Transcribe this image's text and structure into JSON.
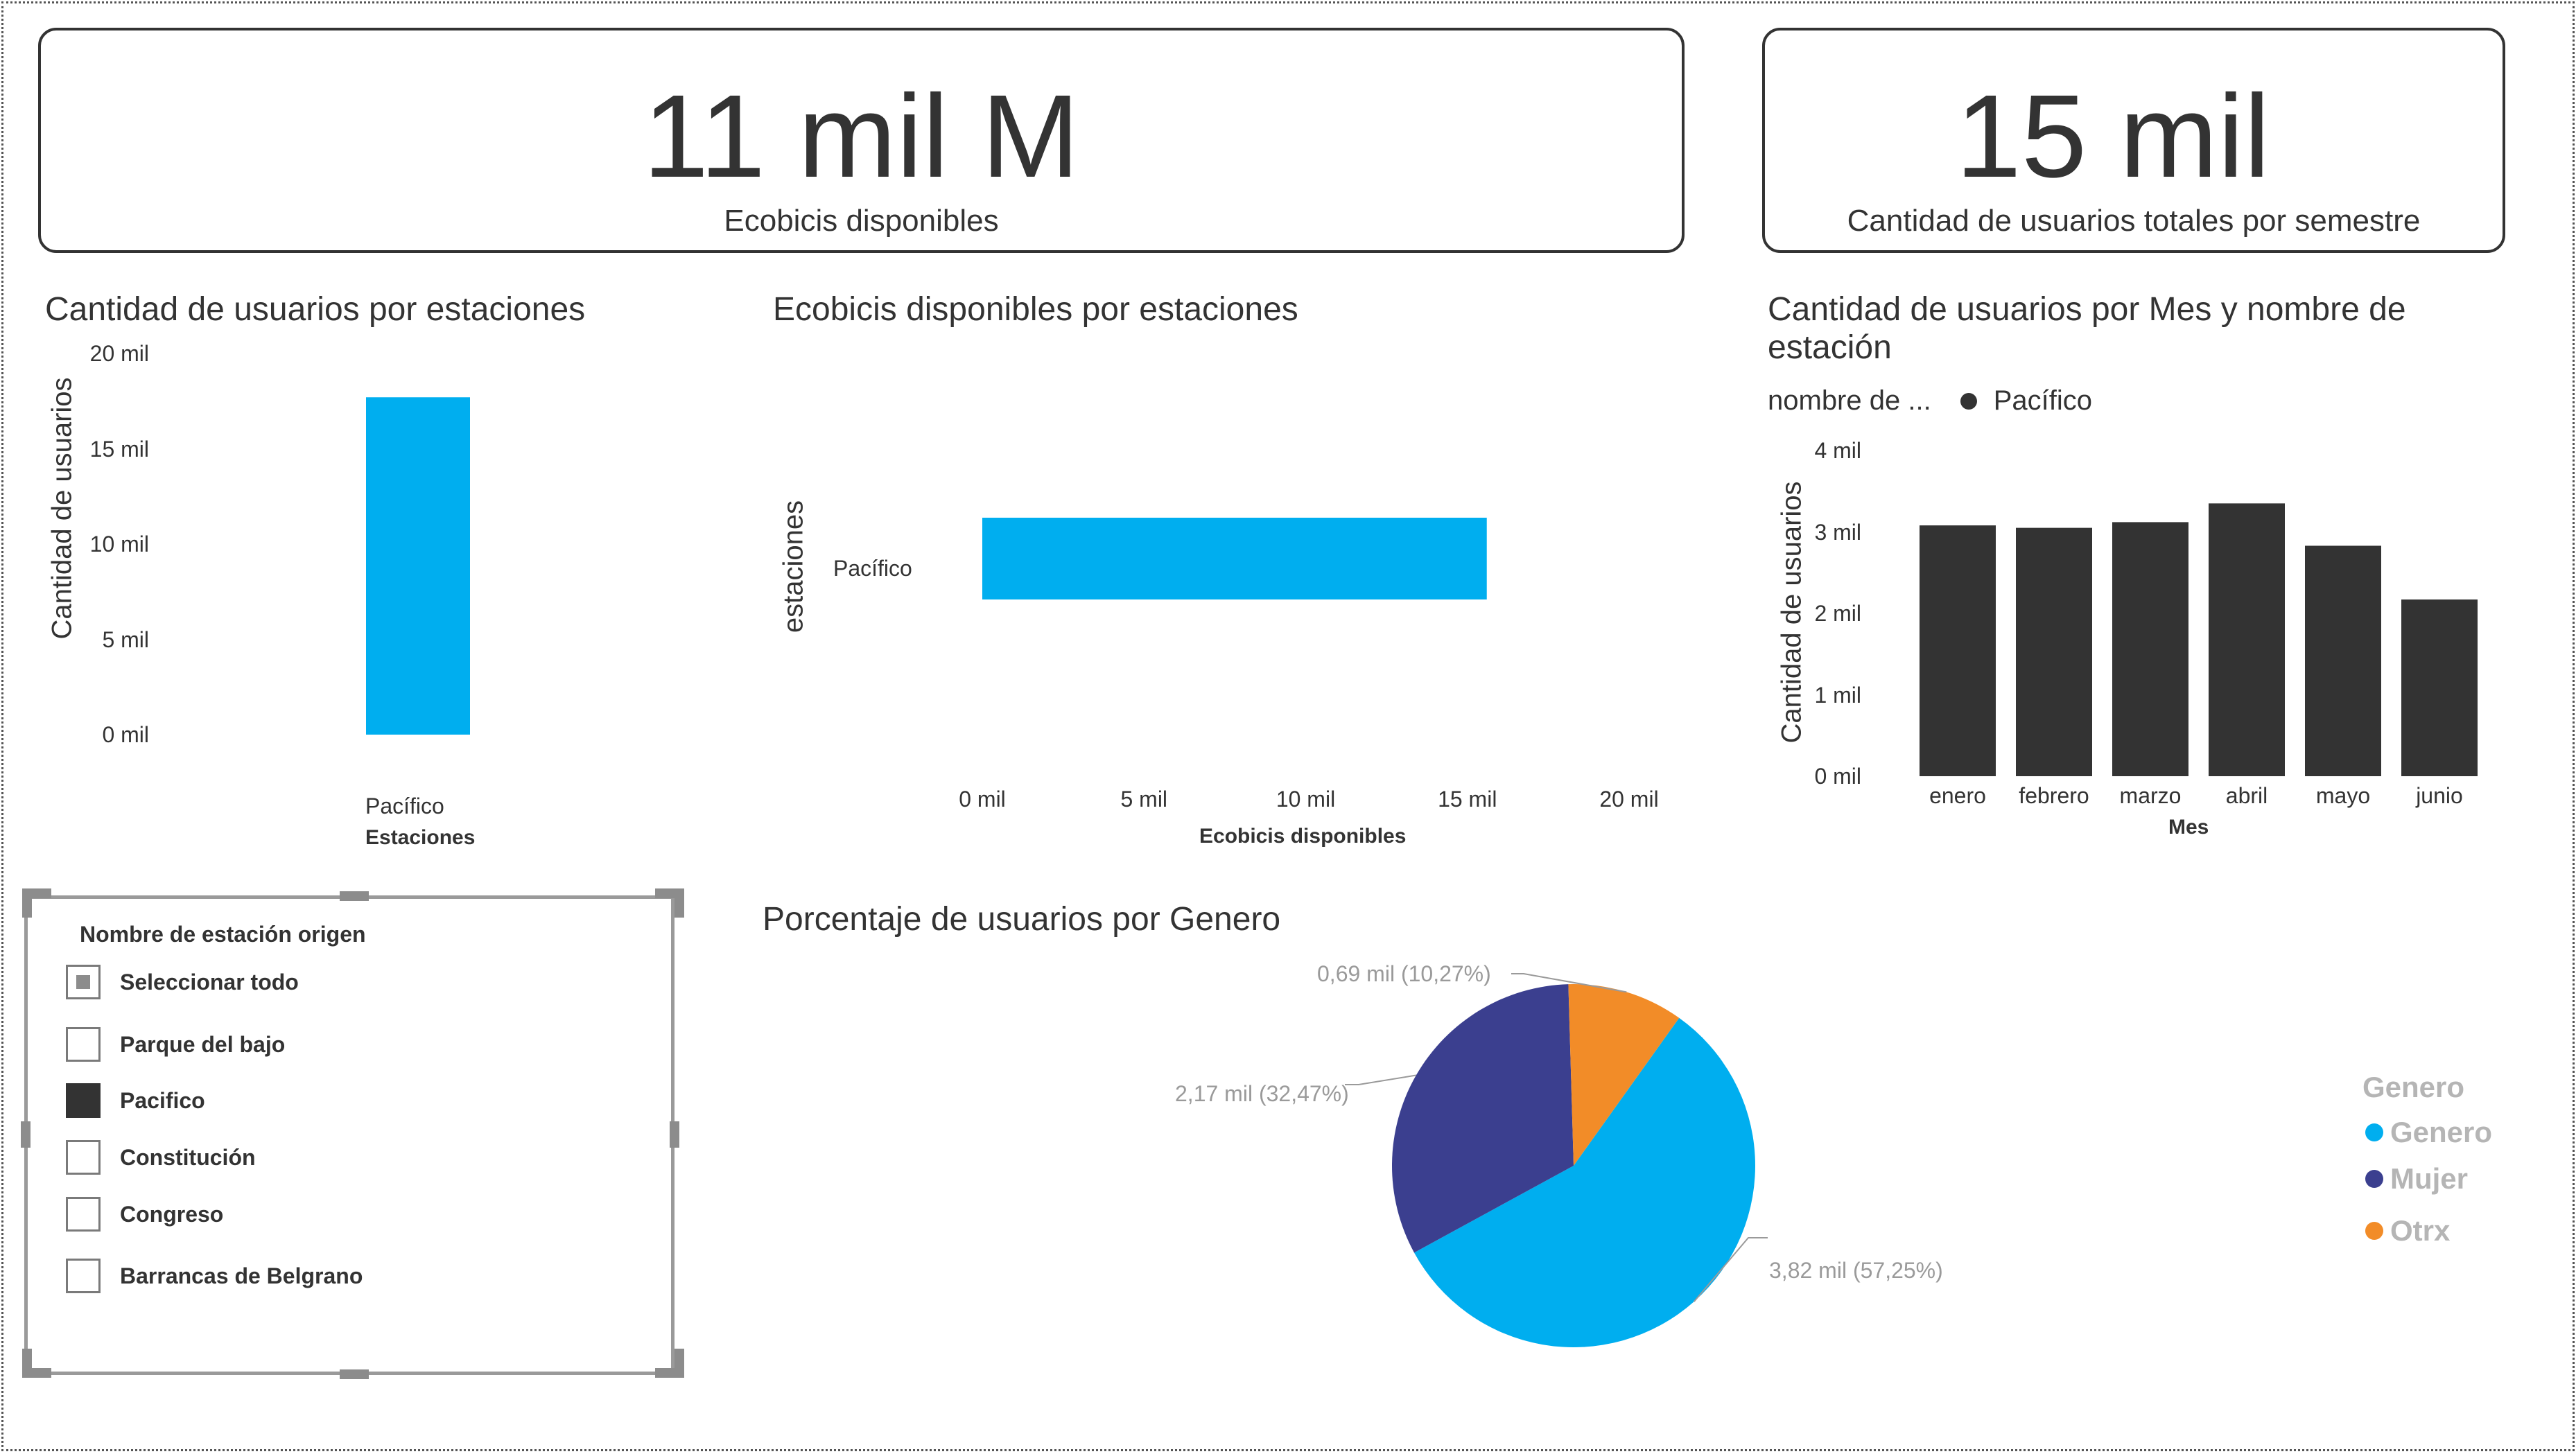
{
  "kpi_cards": [
    {
      "value": "11 mil M",
      "label": "Ecobicis disponibles"
    },
    {
      "value": "15 mil",
      "label": "Cantidad de usuarios totales por semestre"
    }
  ],
  "colors": {
    "accent": "#00aeef",
    "dark": "#333333",
    "mujer": "#3b3f8f",
    "otrx": "#f28c28",
    "muted": "#b5b5b5"
  },
  "chart_users_station": {
    "title": "Cantidad de usuarios por estaciones",
    "y_axis_title": "Cantidad de usuarios",
    "x_axis_title": "Estaciones",
    "y_ticks": [
      "20 mil",
      "15 mil",
      "10 mil",
      "5 mil",
      "0 mil"
    ]
  },
  "chart_bikes_station": {
    "title": "Ecobicis disponibles por estaciones",
    "y_axis_title": "estaciones",
    "x_axis_title": "Ecobicis disponibles",
    "x_ticks": [
      "0 mil",
      "5 mil",
      "10 mil",
      "15 mil",
      "20 mil"
    ]
  },
  "chart_month": {
    "title_line1": "Cantidad de usuarios por Mes y nombre de",
    "title_line2": "estación",
    "legend_label": "nombre de ...",
    "legend_item": "Pacífico",
    "y_axis_title": "Cantidad de usuarios",
    "x_axis_title": "Mes",
    "y_ticks": [
      "4 mil",
      "3 mil",
      "2  mil",
      "1 mil",
      "0 mil"
    ]
  },
  "chart_gender": {
    "title": "Porcentaje de usuarios por Genero",
    "legend_title": "Genero",
    "slice_labels": [
      "3,82 mil (57,25%)",
      "2,17 mil (32,47%)",
      "0,69 mil (10,27%)"
    ]
  },
  "chart_data": [
    {
      "type": "bar",
      "title": "Cantidad de usuarios por estaciones",
      "categories": [
        "Pacífico"
      ],
      "values": [
        17700
      ],
      "xlabel": "Estaciones",
      "ylabel": "Cantidad de usuarios",
      "ylim": [
        0,
        20000
      ],
      "color": "#00aeef"
    },
    {
      "type": "bar",
      "orientation": "horizontal",
      "title": "Ecobicis disponibles por estaciones",
      "categories": [
        "Pacífico"
      ],
      "values": [
        15600
      ],
      "xlabel": "Ecobicis disponibles",
      "ylabel": "estaciones",
      "xlim": [
        0,
        20000
      ],
      "color": "#00aeef"
    },
    {
      "type": "bar",
      "title": "Cantidad de usuarios por Mes y nombre de estación",
      "categories": [
        "enero",
        "febrero",
        "marzo",
        "abril",
        "mayo",
        "junio"
      ],
      "series": [
        {
          "name": "Pacífico",
          "values": [
            3080,
            3050,
            3120,
            3350,
            2830,
            2170
          ]
        }
      ],
      "xlabel": "Mes",
      "ylabel": "Cantidad de usuarios",
      "ylim": [
        0,
        4000
      ],
      "color": "#333333"
    },
    {
      "type": "pie",
      "title": "Porcentaje de usuarios por Genero",
      "labels": [
        "Genero",
        "Mujer",
        "Otrx"
      ],
      "values": [
        3820,
        2170,
        690
      ],
      "percentages": [
        57.25,
        32.47,
        10.27
      ],
      "colors": [
        "#00aeef",
        "#3b3f8f",
        "#f28c28"
      ]
    }
  ],
  "slicer": {
    "title": "Nombre de estación origen",
    "items": [
      {
        "label": "Seleccionar todo",
        "state": "partial"
      },
      {
        "label": "Parque del bajo",
        "state": "unchecked"
      },
      {
        "label": "Pacifico",
        "state": "checked"
      },
      {
        "label": "Constitución",
        "state": "unchecked"
      },
      {
        "label": "Congreso",
        "state": "unchecked"
      },
      {
        "label": "Barrancas de Belgrano",
        "state": "unchecked"
      }
    ]
  }
}
